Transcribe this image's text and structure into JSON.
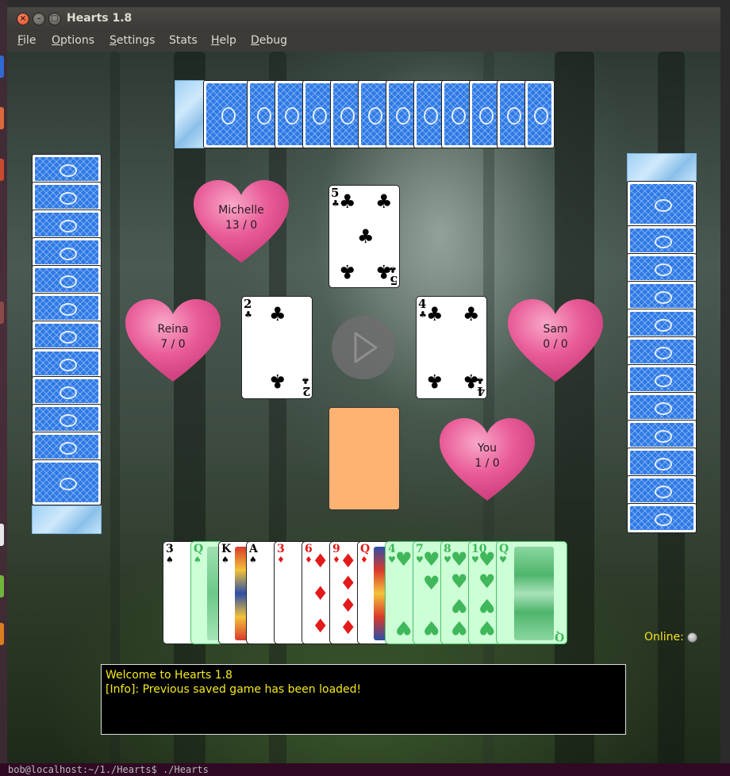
{
  "window": {
    "title": "Hearts 1.8",
    "close_glyph": "×",
    "minimize_glyph": "–",
    "maximize_glyph": "□"
  },
  "menu": [
    {
      "label": "File",
      "mnemonic": "F",
      "rest": "ile"
    },
    {
      "label": "Options",
      "mnemonic": "O",
      "rest": "ptions"
    },
    {
      "label": "Settings",
      "mnemonic": "S",
      "rest": "ettings"
    },
    {
      "label": "Stats",
      "mnemonic": "",
      "rest": "Stats"
    },
    {
      "label": "Help",
      "mnemonic": "H",
      "rest": "elp"
    },
    {
      "label": "Debug",
      "mnemonic": "D",
      "rest": "ebug"
    }
  ],
  "players": {
    "north": {
      "name": "Michelle",
      "score": "13 / 0"
    },
    "west": {
      "name": "Reina",
      "score": "7 / 0"
    },
    "east": {
      "name": "Sam",
      "score": "0 / 0"
    },
    "south": {
      "name": "You",
      "score": "1 / 0"
    }
  },
  "trick": {
    "north": {
      "rank": "5",
      "suit": "♣"
    },
    "west": {
      "rank": "2",
      "suit": "♣"
    },
    "east": {
      "rank": "4",
      "suit": "♣"
    }
  },
  "hand": [
    {
      "rank": "3",
      "suit": "♠",
      "color": "black",
      "playable": true
    },
    {
      "rank": "Q",
      "suit": "♠",
      "color": "black",
      "playable": false
    },
    {
      "rank": "K",
      "suit": "♠",
      "color": "black",
      "playable": true
    },
    {
      "rank": "A",
      "suit": "♠",
      "color": "black",
      "playable": true
    },
    {
      "rank": "3",
      "suit": "♦",
      "color": "red",
      "playable": true
    },
    {
      "rank": "6",
      "suit": "♦",
      "color": "red",
      "playable": true
    },
    {
      "rank": "9",
      "suit": "♦",
      "color": "red",
      "playable": true
    },
    {
      "rank": "Q",
      "suit": "♦",
      "color": "red",
      "playable": true
    },
    {
      "rank": "4",
      "suit": "♥",
      "color": "red",
      "playable": false
    },
    {
      "rank": "7",
      "suit": "♥",
      "color": "red",
      "playable": false
    },
    {
      "rank": "8",
      "suit": "♥",
      "color": "red",
      "playable": false
    },
    {
      "rank": "10",
      "suit": "♥",
      "color": "red",
      "playable": false
    },
    {
      "rank": "Q",
      "suit": "♥",
      "color": "red",
      "playable": false
    }
  ],
  "status": {
    "online_label": "Online:"
  },
  "log": {
    "lines": [
      "Welcome to Hearts 1.8",
      "[Info]: Previous saved game has been loaded!"
    ]
  },
  "terminal": {
    "text": "bob@localhost:~/1./Hearts$ ./Hearts"
  },
  "colors": {
    "heart": "#e54f8f",
    "card_back": "#2e7ae6",
    "empty_slot": "#ffb373",
    "log_text": "#f5ea1c",
    "disabled_card": "#ccffd6"
  },
  "icons": {
    "play": "play-icon",
    "card_back_pattern": "card-back-icon"
  }
}
